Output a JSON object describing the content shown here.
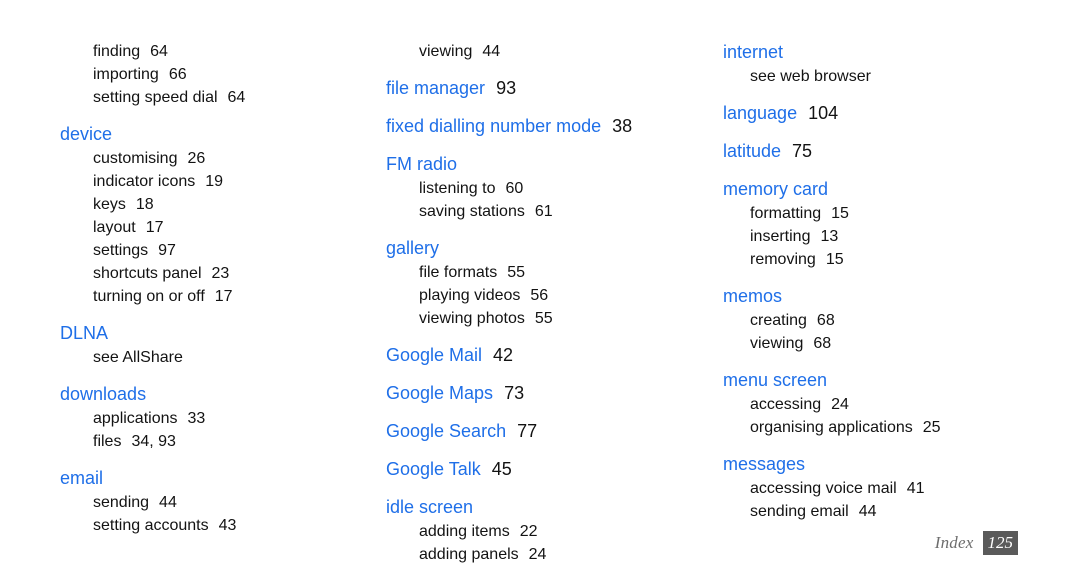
{
  "document": {
    "type": "index",
    "footer": {
      "label": "Index",
      "page_number": "125"
    },
    "colors": {
      "heading": "#1f6fe8",
      "body": "#131313",
      "footer_label": "#6d6d6d",
      "footer_badge_bg": "#5a5a5a",
      "footer_badge_text": "#ffffff",
      "background": "#ffffff"
    }
  },
  "columns": [
    {
      "id": "column-1",
      "entries": [
        {
          "kind": "subitem",
          "label": "finding",
          "page": "64"
        },
        {
          "kind": "subitem",
          "label": "importing",
          "page": "66"
        },
        {
          "kind": "subitem",
          "label": "setting speed dial",
          "page": "64"
        },
        {
          "kind": "heading",
          "label": "device",
          "page": ""
        },
        {
          "kind": "subitem",
          "label": "customising",
          "page": "26"
        },
        {
          "kind": "subitem",
          "label": "indicator icons",
          "page": "19"
        },
        {
          "kind": "subitem",
          "label": "keys",
          "page": "18"
        },
        {
          "kind": "subitem",
          "label": "layout",
          "page": "17"
        },
        {
          "kind": "subitem",
          "label": "settings",
          "page": "97"
        },
        {
          "kind": "subitem",
          "label": "shortcuts panel",
          "page": "23"
        },
        {
          "kind": "subitem",
          "label": "turning on or off",
          "page": "17"
        },
        {
          "kind": "heading",
          "label": "DLNA",
          "page": ""
        },
        {
          "kind": "subitem",
          "label": "see AllShare",
          "page": ""
        },
        {
          "kind": "heading",
          "label": "downloads",
          "page": ""
        },
        {
          "kind": "subitem",
          "label": "applications",
          "page": "33"
        },
        {
          "kind": "subitem",
          "label": "files",
          "page": "34, 93"
        },
        {
          "kind": "heading",
          "label": "email",
          "page": ""
        },
        {
          "kind": "subitem",
          "label": "sending",
          "page": "44"
        },
        {
          "kind": "subitem",
          "label": "setting accounts",
          "page": "43"
        }
      ]
    },
    {
      "id": "column-2",
      "entries": [
        {
          "kind": "subitem",
          "label": "viewing",
          "page": "44"
        },
        {
          "kind": "heading",
          "label": "file manager",
          "page": "93"
        },
        {
          "kind": "heading",
          "label": "fixed dialling number mode",
          "page": "38"
        },
        {
          "kind": "heading",
          "label": "FM radio",
          "page": ""
        },
        {
          "kind": "subitem",
          "label": "listening to",
          "page": "60"
        },
        {
          "kind": "subitem",
          "label": "saving stations",
          "page": "61"
        },
        {
          "kind": "heading",
          "label": "gallery",
          "page": ""
        },
        {
          "kind": "subitem",
          "label": "file formats",
          "page": "55"
        },
        {
          "kind": "subitem",
          "label": "playing videos",
          "page": "56"
        },
        {
          "kind": "subitem",
          "label": "viewing photos",
          "page": "55"
        },
        {
          "kind": "heading",
          "label": "Google Mail",
          "page": "42"
        },
        {
          "kind": "heading",
          "label": "Google Maps",
          "page": "73"
        },
        {
          "kind": "heading",
          "label": "Google Search",
          "page": "77"
        },
        {
          "kind": "heading",
          "label": "Google Talk",
          "page": "45"
        },
        {
          "kind": "heading",
          "label": "idle screen",
          "page": ""
        },
        {
          "kind": "subitem",
          "label": "adding items",
          "page": "22"
        },
        {
          "kind": "subitem",
          "label": "adding panels",
          "page": "24"
        }
      ]
    },
    {
      "id": "column-3",
      "entries": [
        {
          "kind": "heading",
          "label": "internet",
          "page": ""
        },
        {
          "kind": "subitem",
          "label": "see web browser",
          "page": ""
        },
        {
          "kind": "heading",
          "label": "language",
          "page": "104"
        },
        {
          "kind": "heading",
          "label": "latitude",
          "page": "75"
        },
        {
          "kind": "heading",
          "label": "memory card",
          "page": ""
        },
        {
          "kind": "subitem",
          "label": "formatting",
          "page": "15"
        },
        {
          "kind": "subitem",
          "label": "inserting",
          "page": "13"
        },
        {
          "kind": "subitem",
          "label": "removing",
          "page": "15"
        },
        {
          "kind": "heading",
          "label": "memos",
          "page": ""
        },
        {
          "kind": "subitem",
          "label": "creating",
          "page": "68"
        },
        {
          "kind": "subitem",
          "label": "viewing",
          "page": "68"
        },
        {
          "kind": "heading",
          "label": "menu screen",
          "page": ""
        },
        {
          "kind": "subitem",
          "label": "accessing",
          "page": "24"
        },
        {
          "kind": "subitem",
          "label": "organising applications",
          "page": "25"
        },
        {
          "kind": "heading",
          "label": "messages",
          "page": ""
        },
        {
          "kind": "subitem",
          "label": "accessing voice mail",
          "page": "41"
        },
        {
          "kind": "subitem",
          "label": "sending email",
          "page": "44"
        }
      ]
    }
  ]
}
